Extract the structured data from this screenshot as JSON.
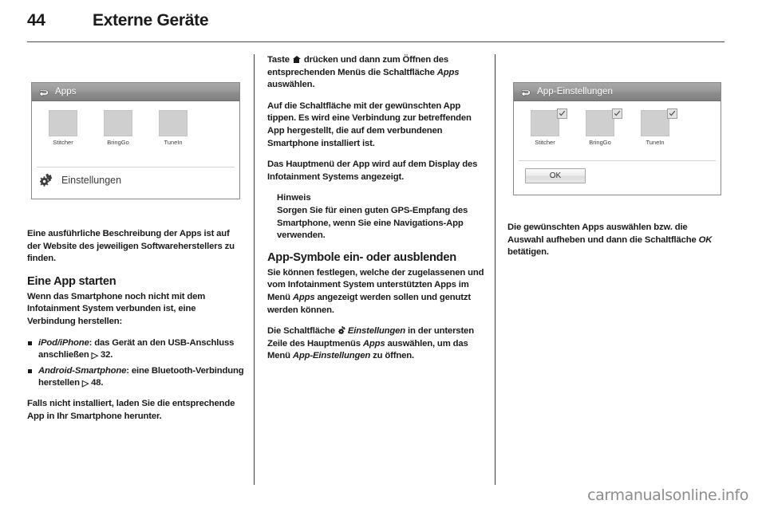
{
  "page": {
    "folio": "44",
    "chapter_title": "Externe Geräte",
    "watermark": "carmanualsonline.info"
  },
  "figure_apps": {
    "title": "Apps",
    "back_icon": "back-arrow-icon",
    "apps": [
      {
        "label": "Stitcher"
      },
      {
        "label": "BringGo"
      },
      {
        "label": "TuneIn"
      }
    ],
    "settings_label": "Einstellungen",
    "settings_icon": "gear-icon"
  },
  "figure_app_settings": {
    "title": "App-Einstellungen",
    "back_icon": "back-arrow-icon",
    "apps": [
      {
        "label": "Stitcher",
        "checked": true
      },
      {
        "label": "BringGo",
        "checked": true
      },
      {
        "label": "TuneIn",
        "checked": true
      }
    ],
    "ok_label": "OK"
  },
  "column1": {
    "intro": "Eine ausführliche Beschreibung der Apps ist auf der Website des jeweiligen Softwareherstellers zu finden.",
    "heading_start_app": "Eine App starten",
    "start_app_text": "Wenn das Smartphone noch nicht mit dem Infotainment System verbunden ist, eine Verbindung herstellen:",
    "bullets": [
      {
        "device_label": "iPod/iPhone",
        "text": ": das Gerät an den USB-Anschluss anschließen ",
        "ref": "32."
      },
      {
        "device_label": "Android-Smartphone",
        "text": ": eine Bluetooth-Verbindung herstellen ",
        "ref": "48."
      }
    ],
    "install_text": "Falls nicht installiert, laden Sie die entsprechende App in Ihr Smartphone herunter."
  },
  "column2": {
    "para_key_press_a": "Taste ",
    "para_key_press_b": " drücken und dann zum Öffnen des entsprechenden Menüs die Schaltfläche ",
    "para_key_press_menu": "Apps",
    "para_key_press_c": " auswählen.",
    "para_tap": "Auf die Schaltfläche mit der gewünschten App tippen. Es wird eine Verbindung zur betreffenden App hergestellt, die auf dem verbundenen Smartphone installiert ist.",
    "para_main_menu": "Das Hauptmenü der App wird auf dem Display des Infotainment Systems angezeigt.",
    "note_title": "Hinweis",
    "note_body": "Sorgen Sie für einen guten GPS-Empfang des Smartphone, wenn Sie eine Navigations-App verwenden.",
    "heading_icons": "App-Symbole ein- oder ausblenden",
    "para_icons_a": "Sie können festlegen, welche der zugelassenen und vom Infotainment System unterstützten Apps im Menü ",
    "para_icons_menu": "Apps",
    "para_icons_b": " angezeigt werden sollen und genutzt werden können.",
    "para_settings_a": "Die Schaltfläche ",
    "para_settings_gear_label": "Einstellungen",
    "para_settings_b": " in der untersten Zeile des Hauptmenüs ",
    "para_settings_menu": "Apps",
    "para_settings_c": " auswählen, um das Menü ",
    "para_settings_menu2": "App-Einstellungen",
    "para_settings_d": " zu öffnen."
  },
  "column3": {
    "para_select_a": "Die gewünschten Apps auswählen bzw. die Auswahl aufheben und dann die Schaltfläche ",
    "para_select_ok": "OK",
    "para_select_b": " betätigen."
  }
}
